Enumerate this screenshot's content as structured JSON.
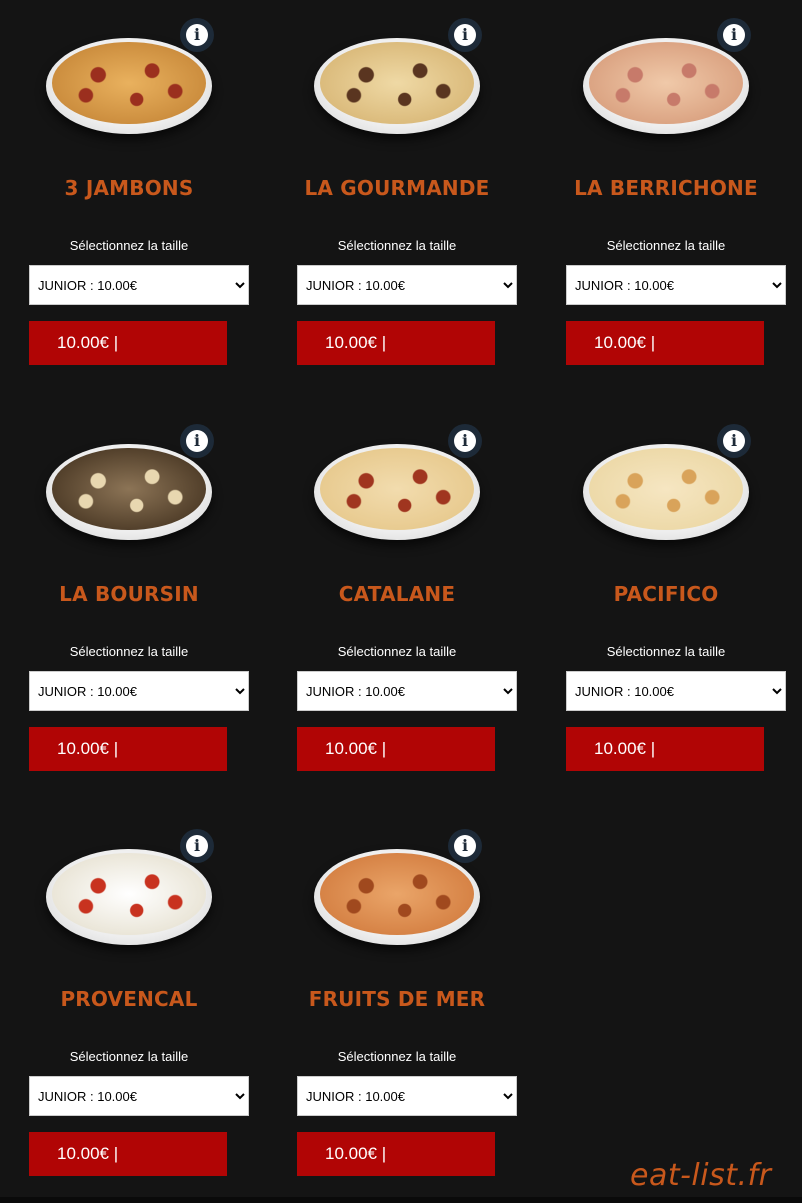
{
  "menu": {
    "size_label": "Sélectionnez la taille",
    "products": [
      {
        "name": "3 JAMBONS",
        "size_option": "JUNIOR : 10.00€",
        "price": "10.00€ |",
        "pizza_colors": [
          "#c98a3b",
          "#e9b15e",
          "#9b2f1e"
        ]
      },
      {
        "name": "LA GOURMANDE",
        "size_option": "JUNIOR : 10.00€",
        "price": "10.00€ |",
        "pizza_colors": [
          "#d9b878",
          "#efd9a5",
          "#5a3520"
        ]
      },
      {
        "name": "LA BERRICHONE",
        "size_option": "JUNIOR : 10.00€",
        "price": "10.00€ |",
        "pizza_colors": [
          "#d9a07f",
          "#f0c9a9",
          "#c77a6a"
        ]
      },
      {
        "name": "LA BOURSIN",
        "size_option": "JUNIOR : 10.00€",
        "price": "10.00€ |",
        "pizza_colors": [
          "#4c3a26",
          "#8c7456",
          "#e8d7b0"
        ]
      },
      {
        "name": "CATALANE",
        "size_option": "JUNIOR : 10.00€",
        "price": "10.00€ |",
        "pizza_colors": [
          "#e7c98d",
          "#f2dcae",
          "#a0351f"
        ]
      },
      {
        "name": "PACIFICO",
        "size_option": "JUNIOR : 10.00€",
        "price": "10.00€ |",
        "pizza_colors": [
          "#ecd8a6",
          "#f6e6c2",
          "#d9a35a"
        ]
      },
      {
        "name": "PROVENCAL",
        "size_option": "JUNIOR : 10.00€",
        "price": "10.00€ |",
        "pizza_colors": [
          "#e8e3d4",
          "#ffffff",
          "#c8321f"
        ]
      },
      {
        "name": "FRUITS DE MER",
        "size_option": "JUNIOR : 10.00€",
        "price": "10.00€ |",
        "pizza_colors": [
          "#d47f42",
          "#eaa569",
          "#a0491e"
        ]
      }
    ]
  },
  "watermark": "eat-list.fr",
  "colors": {
    "background": "#141414",
    "title": "#c8581c",
    "button": "#b10505",
    "info_icon": "#1d2a38"
  },
  "icons": {
    "info": "info-icon",
    "dropdown": "chevron-down-icon"
  }
}
